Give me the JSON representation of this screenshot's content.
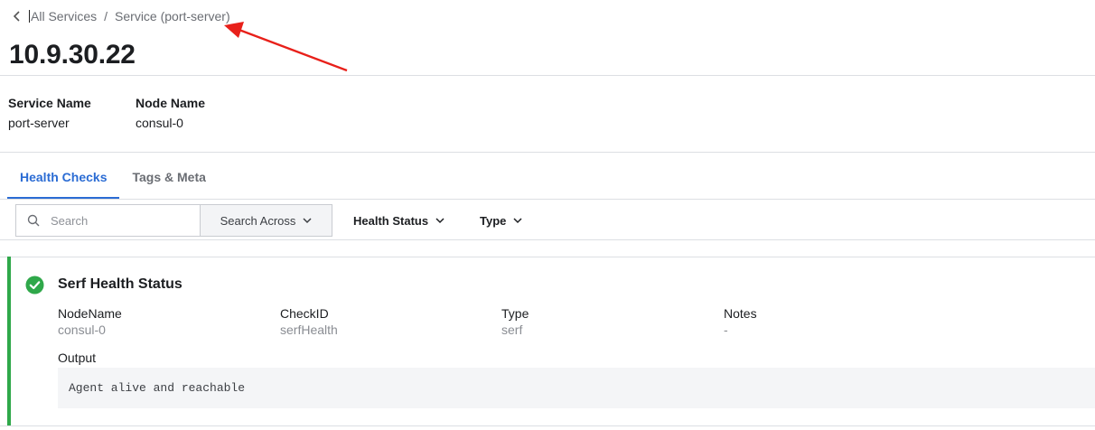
{
  "breadcrumb": {
    "parent": "All Services",
    "separator": "/",
    "current": "Service (port-server)"
  },
  "title": "10.9.30.22",
  "details": {
    "service_name_label": "Service Name",
    "service_name_value": "port-server",
    "node_name_label": "Node Name",
    "node_name_value": "consul-0"
  },
  "tabs": [
    {
      "label": "Health Checks",
      "active": true
    },
    {
      "label": "Tags & Meta",
      "active": false
    }
  ],
  "filters": {
    "search_placeholder": "Search",
    "search_across": "Search Across",
    "health_status": "Health Status",
    "type": "Type"
  },
  "check": {
    "status": "passing",
    "status_color": "#2fa84a",
    "title": "Serf Health Status",
    "fields": [
      {
        "label": "NodeName",
        "value": "consul-0"
      },
      {
        "label": "CheckID",
        "value": "serfHealth"
      },
      {
        "label": "Type",
        "value": "serf"
      },
      {
        "label": "Notes",
        "value": "-"
      }
    ],
    "output_label": "Output",
    "output_text": "Agent alive and reachable"
  },
  "colors": {
    "accent": "#2b6cd4",
    "annotation_arrow": "#e8201a"
  }
}
